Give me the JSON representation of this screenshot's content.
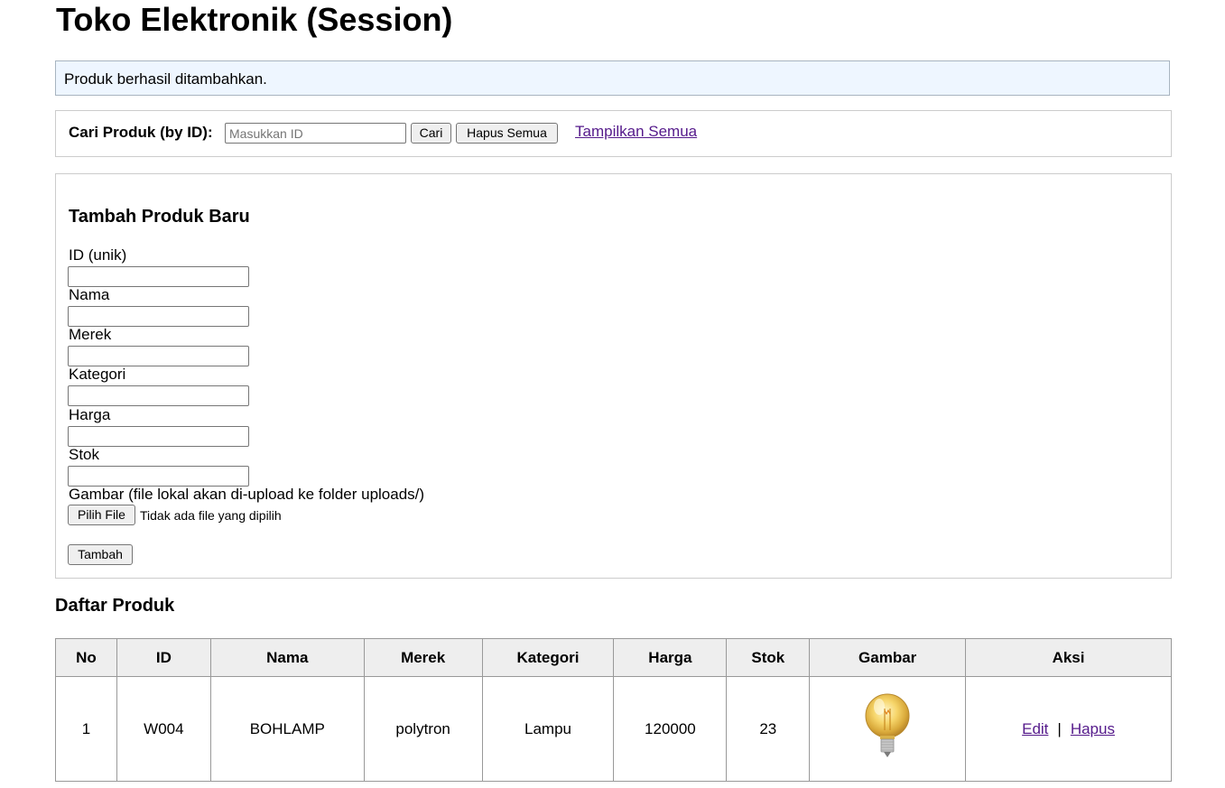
{
  "page_title": "Toko Elektronik (Session)",
  "notice": "Produk berhasil ditambahkan.",
  "search": {
    "label": "Cari Produk (by ID):",
    "placeholder": "Masukkan ID",
    "value": "",
    "search_button": "Cari",
    "clear_button": "Hapus Semua",
    "show_all_link": "Tampilkan Semua"
  },
  "form": {
    "title": "Tambah Produk Baru",
    "fields": {
      "id": "ID (unik)",
      "nama": "Nama",
      "merek": "Merek",
      "kategori": "Kategori",
      "harga": "Harga",
      "stok": "Stok",
      "gambar": "Gambar (file lokal akan di-upload ke folder uploads/)"
    },
    "file_button": "Pilih File",
    "file_status": "Tidak ada file yang dipilih",
    "submit_button": "Tambah"
  },
  "list": {
    "title": "Daftar Produk",
    "columns": [
      "No",
      "ID",
      "Nama",
      "Merek",
      "Kategori",
      "Harga",
      "Stok",
      "Gambar",
      "Aksi"
    ],
    "rows": [
      {
        "no": "1",
        "id": "W004",
        "nama": "BOHLAMP",
        "merek": "polytron",
        "kategori": "Lampu",
        "harga": "120000",
        "stok": "23",
        "gambar_icon": "light-bulb-image",
        "edit_label": "Edit",
        "delete_label": "Hapus"
      }
    ],
    "action_separator": "|"
  },
  "colors": {
    "notice_bg": "#eef6ff",
    "link": "#551a8b",
    "header_bg": "#eeeeee"
  }
}
